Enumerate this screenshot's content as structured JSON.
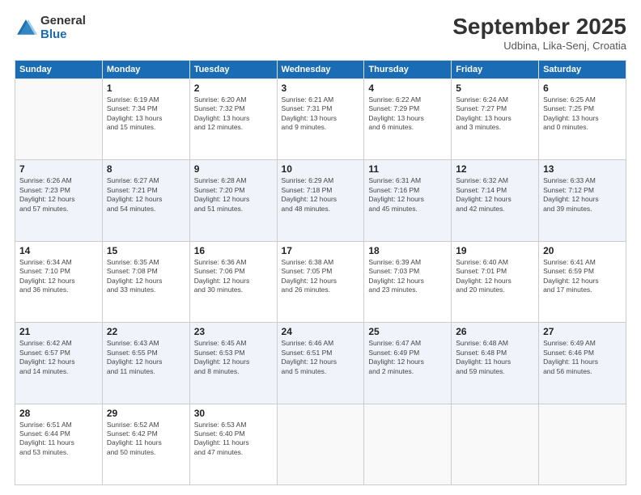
{
  "logo": {
    "general": "General",
    "blue": "Blue"
  },
  "title": "September 2025",
  "subtitle": "Udbina, Lika-Senj, Croatia",
  "weekdays": [
    "Sunday",
    "Monday",
    "Tuesday",
    "Wednesday",
    "Thursday",
    "Friday",
    "Saturday"
  ],
  "weeks": [
    [
      {
        "day": "",
        "info": ""
      },
      {
        "day": "1",
        "info": "Sunrise: 6:19 AM\nSunset: 7:34 PM\nDaylight: 13 hours\nand 15 minutes."
      },
      {
        "day": "2",
        "info": "Sunrise: 6:20 AM\nSunset: 7:32 PM\nDaylight: 13 hours\nand 12 minutes."
      },
      {
        "day": "3",
        "info": "Sunrise: 6:21 AM\nSunset: 7:31 PM\nDaylight: 13 hours\nand 9 minutes."
      },
      {
        "day": "4",
        "info": "Sunrise: 6:22 AM\nSunset: 7:29 PM\nDaylight: 13 hours\nand 6 minutes."
      },
      {
        "day": "5",
        "info": "Sunrise: 6:24 AM\nSunset: 7:27 PM\nDaylight: 13 hours\nand 3 minutes."
      },
      {
        "day": "6",
        "info": "Sunrise: 6:25 AM\nSunset: 7:25 PM\nDaylight: 13 hours\nand 0 minutes."
      }
    ],
    [
      {
        "day": "7",
        "info": "Sunrise: 6:26 AM\nSunset: 7:23 PM\nDaylight: 12 hours\nand 57 minutes."
      },
      {
        "day": "8",
        "info": "Sunrise: 6:27 AM\nSunset: 7:21 PM\nDaylight: 12 hours\nand 54 minutes."
      },
      {
        "day": "9",
        "info": "Sunrise: 6:28 AM\nSunset: 7:20 PM\nDaylight: 12 hours\nand 51 minutes."
      },
      {
        "day": "10",
        "info": "Sunrise: 6:29 AM\nSunset: 7:18 PM\nDaylight: 12 hours\nand 48 minutes."
      },
      {
        "day": "11",
        "info": "Sunrise: 6:31 AM\nSunset: 7:16 PM\nDaylight: 12 hours\nand 45 minutes."
      },
      {
        "day": "12",
        "info": "Sunrise: 6:32 AM\nSunset: 7:14 PM\nDaylight: 12 hours\nand 42 minutes."
      },
      {
        "day": "13",
        "info": "Sunrise: 6:33 AM\nSunset: 7:12 PM\nDaylight: 12 hours\nand 39 minutes."
      }
    ],
    [
      {
        "day": "14",
        "info": "Sunrise: 6:34 AM\nSunset: 7:10 PM\nDaylight: 12 hours\nand 36 minutes."
      },
      {
        "day": "15",
        "info": "Sunrise: 6:35 AM\nSunset: 7:08 PM\nDaylight: 12 hours\nand 33 minutes."
      },
      {
        "day": "16",
        "info": "Sunrise: 6:36 AM\nSunset: 7:06 PM\nDaylight: 12 hours\nand 30 minutes."
      },
      {
        "day": "17",
        "info": "Sunrise: 6:38 AM\nSunset: 7:05 PM\nDaylight: 12 hours\nand 26 minutes."
      },
      {
        "day": "18",
        "info": "Sunrise: 6:39 AM\nSunset: 7:03 PM\nDaylight: 12 hours\nand 23 minutes."
      },
      {
        "day": "19",
        "info": "Sunrise: 6:40 AM\nSunset: 7:01 PM\nDaylight: 12 hours\nand 20 minutes."
      },
      {
        "day": "20",
        "info": "Sunrise: 6:41 AM\nSunset: 6:59 PM\nDaylight: 12 hours\nand 17 minutes."
      }
    ],
    [
      {
        "day": "21",
        "info": "Sunrise: 6:42 AM\nSunset: 6:57 PM\nDaylight: 12 hours\nand 14 minutes."
      },
      {
        "day": "22",
        "info": "Sunrise: 6:43 AM\nSunset: 6:55 PM\nDaylight: 12 hours\nand 11 minutes."
      },
      {
        "day": "23",
        "info": "Sunrise: 6:45 AM\nSunset: 6:53 PM\nDaylight: 12 hours\nand 8 minutes."
      },
      {
        "day": "24",
        "info": "Sunrise: 6:46 AM\nSunset: 6:51 PM\nDaylight: 12 hours\nand 5 minutes."
      },
      {
        "day": "25",
        "info": "Sunrise: 6:47 AM\nSunset: 6:49 PM\nDaylight: 12 hours\nand 2 minutes."
      },
      {
        "day": "26",
        "info": "Sunrise: 6:48 AM\nSunset: 6:48 PM\nDaylight: 11 hours\nand 59 minutes."
      },
      {
        "day": "27",
        "info": "Sunrise: 6:49 AM\nSunset: 6:46 PM\nDaylight: 11 hours\nand 56 minutes."
      }
    ],
    [
      {
        "day": "28",
        "info": "Sunrise: 6:51 AM\nSunset: 6:44 PM\nDaylight: 11 hours\nand 53 minutes."
      },
      {
        "day": "29",
        "info": "Sunrise: 6:52 AM\nSunset: 6:42 PM\nDaylight: 11 hours\nand 50 minutes."
      },
      {
        "day": "30",
        "info": "Sunrise: 6:53 AM\nSunset: 6:40 PM\nDaylight: 11 hours\nand 47 minutes."
      },
      {
        "day": "",
        "info": ""
      },
      {
        "day": "",
        "info": ""
      },
      {
        "day": "",
        "info": ""
      },
      {
        "day": "",
        "info": ""
      }
    ]
  ]
}
